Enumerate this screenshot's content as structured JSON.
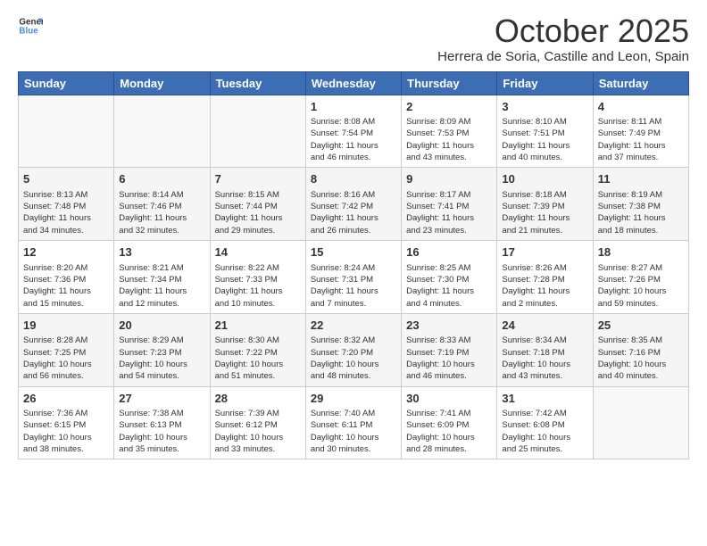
{
  "header": {
    "logo_text_general": "General",
    "logo_text_blue": "Blue",
    "month": "October 2025",
    "location": "Herrera de Soria, Castille and Leon, Spain"
  },
  "days_of_week": [
    "Sunday",
    "Monday",
    "Tuesday",
    "Wednesday",
    "Thursday",
    "Friday",
    "Saturday"
  ],
  "weeks": [
    [
      {
        "day": "",
        "info": ""
      },
      {
        "day": "",
        "info": ""
      },
      {
        "day": "",
        "info": ""
      },
      {
        "day": "1",
        "info": "Sunrise: 8:08 AM\nSunset: 7:54 PM\nDaylight: 11 hours\nand 46 minutes."
      },
      {
        "day": "2",
        "info": "Sunrise: 8:09 AM\nSunset: 7:53 PM\nDaylight: 11 hours\nand 43 minutes."
      },
      {
        "day": "3",
        "info": "Sunrise: 8:10 AM\nSunset: 7:51 PM\nDaylight: 11 hours\nand 40 minutes."
      },
      {
        "day": "4",
        "info": "Sunrise: 8:11 AM\nSunset: 7:49 PM\nDaylight: 11 hours\nand 37 minutes."
      }
    ],
    [
      {
        "day": "5",
        "info": "Sunrise: 8:13 AM\nSunset: 7:48 PM\nDaylight: 11 hours\nand 34 minutes."
      },
      {
        "day": "6",
        "info": "Sunrise: 8:14 AM\nSunset: 7:46 PM\nDaylight: 11 hours\nand 32 minutes."
      },
      {
        "day": "7",
        "info": "Sunrise: 8:15 AM\nSunset: 7:44 PM\nDaylight: 11 hours\nand 29 minutes."
      },
      {
        "day": "8",
        "info": "Sunrise: 8:16 AM\nSunset: 7:42 PM\nDaylight: 11 hours\nand 26 minutes."
      },
      {
        "day": "9",
        "info": "Sunrise: 8:17 AM\nSunset: 7:41 PM\nDaylight: 11 hours\nand 23 minutes."
      },
      {
        "day": "10",
        "info": "Sunrise: 8:18 AM\nSunset: 7:39 PM\nDaylight: 11 hours\nand 21 minutes."
      },
      {
        "day": "11",
        "info": "Sunrise: 8:19 AM\nSunset: 7:38 PM\nDaylight: 11 hours\nand 18 minutes."
      }
    ],
    [
      {
        "day": "12",
        "info": "Sunrise: 8:20 AM\nSunset: 7:36 PM\nDaylight: 11 hours\nand 15 minutes."
      },
      {
        "day": "13",
        "info": "Sunrise: 8:21 AM\nSunset: 7:34 PM\nDaylight: 11 hours\nand 12 minutes."
      },
      {
        "day": "14",
        "info": "Sunrise: 8:22 AM\nSunset: 7:33 PM\nDaylight: 11 hours\nand 10 minutes."
      },
      {
        "day": "15",
        "info": "Sunrise: 8:24 AM\nSunset: 7:31 PM\nDaylight: 11 hours\nand 7 minutes."
      },
      {
        "day": "16",
        "info": "Sunrise: 8:25 AM\nSunset: 7:30 PM\nDaylight: 11 hours\nand 4 minutes."
      },
      {
        "day": "17",
        "info": "Sunrise: 8:26 AM\nSunset: 7:28 PM\nDaylight: 11 hours\nand 2 minutes."
      },
      {
        "day": "18",
        "info": "Sunrise: 8:27 AM\nSunset: 7:26 PM\nDaylight: 10 hours\nand 59 minutes."
      }
    ],
    [
      {
        "day": "19",
        "info": "Sunrise: 8:28 AM\nSunset: 7:25 PM\nDaylight: 10 hours\nand 56 minutes."
      },
      {
        "day": "20",
        "info": "Sunrise: 8:29 AM\nSunset: 7:23 PM\nDaylight: 10 hours\nand 54 minutes."
      },
      {
        "day": "21",
        "info": "Sunrise: 8:30 AM\nSunset: 7:22 PM\nDaylight: 10 hours\nand 51 minutes."
      },
      {
        "day": "22",
        "info": "Sunrise: 8:32 AM\nSunset: 7:20 PM\nDaylight: 10 hours\nand 48 minutes."
      },
      {
        "day": "23",
        "info": "Sunrise: 8:33 AM\nSunset: 7:19 PM\nDaylight: 10 hours\nand 46 minutes."
      },
      {
        "day": "24",
        "info": "Sunrise: 8:34 AM\nSunset: 7:18 PM\nDaylight: 10 hours\nand 43 minutes."
      },
      {
        "day": "25",
        "info": "Sunrise: 8:35 AM\nSunset: 7:16 PM\nDaylight: 10 hours\nand 40 minutes."
      }
    ],
    [
      {
        "day": "26",
        "info": "Sunrise: 7:36 AM\nSunset: 6:15 PM\nDaylight: 10 hours\nand 38 minutes."
      },
      {
        "day": "27",
        "info": "Sunrise: 7:38 AM\nSunset: 6:13 PM\nDaylight: 10 hours\nand 35 minutes."
      },
      {
        "day": "28",
        "info": "Sunrise: 7:39 AM\nSunset: 6:12 PM\nDaylight: 10 hours\nand 33 minutes."
      },
      {
        "day": "29",
        "info": "Sunrise: 7:40 AM\nSunset: 6:11 PM\nDaylight: 10 hours\nand 30 minutes."
      },
      {
        "day": "30",
        "info": "Sunrise: 7:41 AM\nSunset: 6:09 PM\nDaylight: 10 hours\nand 28 minutes."
      },
      {
        "day": "31",
        "info": "Sunrise: 7:42 AM\nSunset: 6:08 PM\nDaylight: 10 hours\nand 25 minutes."
      },
      {
        "day": "",
        "info": ""
      }
    ]
  ]
}
